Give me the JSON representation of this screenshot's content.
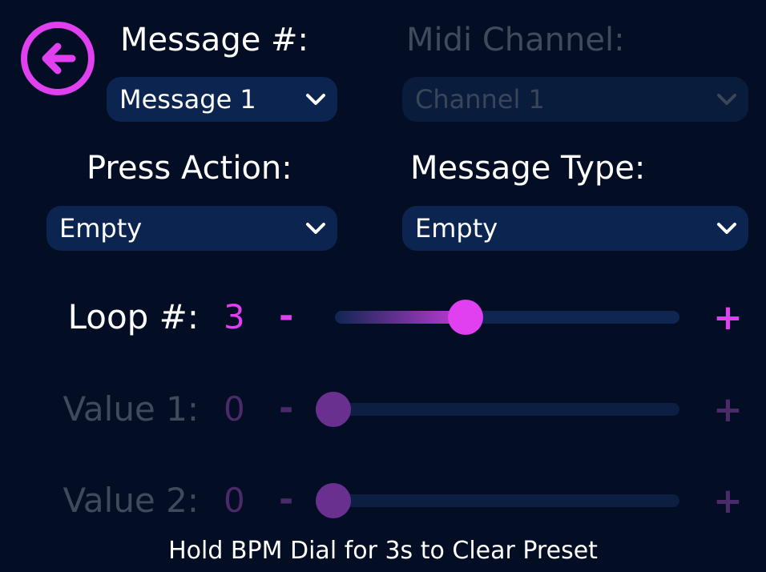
{
  "back_button": {
    "icon": "arrow-left-circle-icon",
    "color": "#e040f0"
  },
  "message_number": {
    "label": "Message #:",
    "selected": "Message 1"
  },
  "midi_channel": {
    "label": "Midi Channel:",
    "selected": "Channel 1",
    "disabled": true
  },
  "press_action": {
    "label": "Press Action:",
    "selected": "Empty"
  },
  "message_type": {
    "label": "Message Type:",
    "selected": "Empty"
  },
  "loop": {
    "label": "Loop #:",
    "value": "3",
    "minus": "-",
    "plus": "+",
    "level": 0.38
  },
  "value1": {
    "label": "Value 1:",
    "value": "0",
    "minus": "-",
    "plus": "+",
    "level": 0.0,
    "disabled": true
  },
  "value2": {
    "label": "Value 2:",
    "value": "0",
    "minus": "-",
    "plus": "+",
    "level": 0.0,
    "disabled": true
  },
  "footer": {
    "text": "Hold BPM Dial for 3s to Clear Preset"
  },
  "colors": {
    "accent": "#e040f0",
    "background": "#030d24",
    "select_bg": "#0c2550",
    "disabled_text": "#3f4a5c"
  }
}
